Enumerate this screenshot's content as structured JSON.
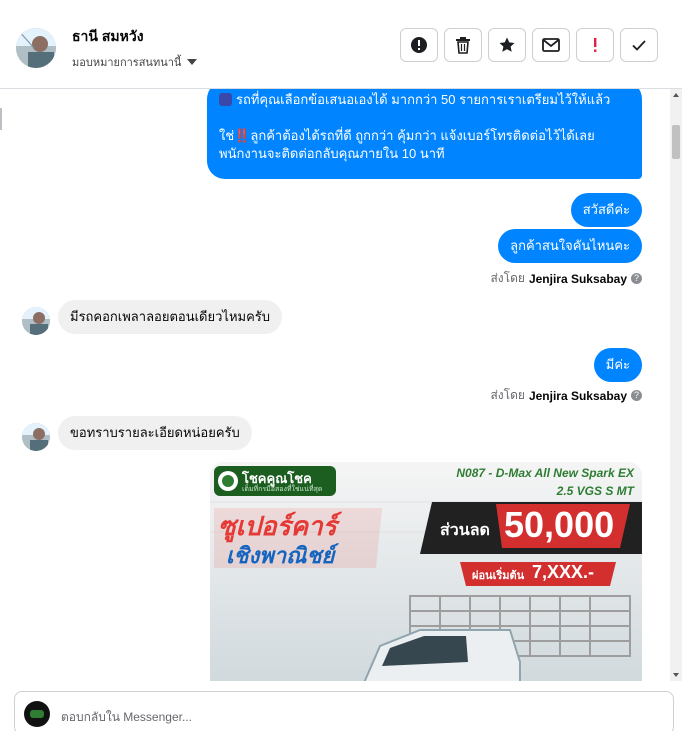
{
  "header": {
    "contact_name": "ธานี สมหวัง",
    "assign_label": "มอบหมายการสนทนานี้"
  },
  "actions": [
    {
      "name": "report-icon"
    },
    {
      "name": "trash-icon"
    },
    {
      "name": "star-icon"
    },
    {
      "name": "mail-icon"
    },
    {
      "name": "important-icon"
    },
    {
      "name": "check-icon"
    }
  ],
  "messages": {
    "m1_line1": "รถที่คุณเลือกข้อเสนอเองได้ มากกว่า 50 รายการเราเตรียมไว้ให้แล้ว",
    "m1_line2": "ใช่‼️ลูกค้าต้องได้รถที่ดี ถูกกว่า คุ้มกว่า แจ้งเบอร์โทรติดต่อไว้ได้เลย",
    "m1_line3": "พนักงานจะติดต่อกลับคุณภายใน 10 นาที",
    "m2": "สวัสดีค่ะ",
    "m3": "ลูกค้าสนใจคันไหนคะ",
    "sent_by_prefix": "ส่งโดย",
    "sent_by_name": "Jenjira Suksabay",
    "m4": "มีรถคอกเพลาลอยตอนเดียวไหมครับ",
    "m5": "มีค่ะ",
    "m6": "ขอทราบรายละเอียดหน่อยครับ"
  },
  "promo": {
    "brand": "โชคคูณโชค",
    "brand_sub": "เต็มที่กรมือสองที่ใช่แน่ที่สุด",
    "model": "N087 - D-Max All New Spark EX",
    "spec": "2.5 VGS S MT",
    "headline1": "ซูเปอร์คาร์",
    "headline2": "เชิงพาณิชย์",
    "discount_label": "ส่วนลด",
    "discount_value": "50,000",
    "installment_label": "ผ่อนเริ่มต้น",
    "installment_value": "7,XXX.-"
  },
  "composer": {
    "placeholder": "ตอบกลับใน Messenger..."
  },
  "colors": {
    "outgoing": "#0084ff",
    "incoming": "#f0f0f0",
    "promo_red": "#d32f2f",
    "promo_green": "#2e7d32"
  }
}
